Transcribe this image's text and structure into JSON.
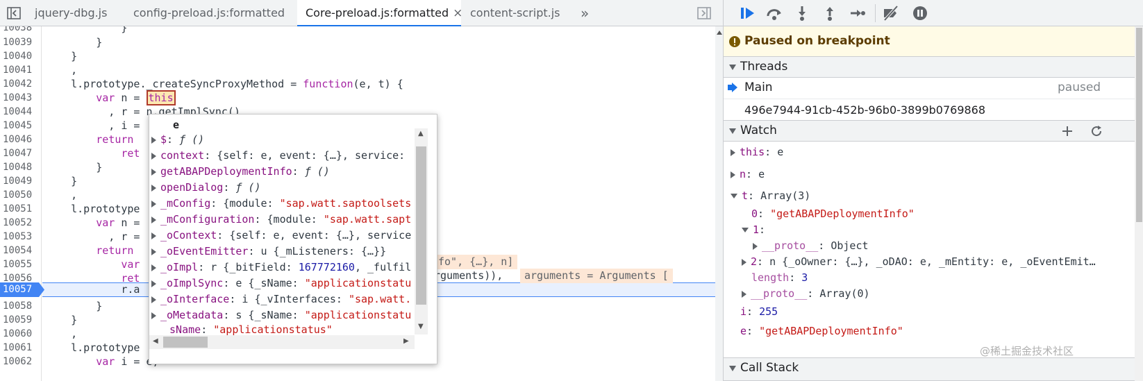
{
  "source": {
    "tabs": [
      {
        "label": "jquery-dbg.js"
      },
      {
        "label": "config-preload.js:formatted"
      },
      {
        "label": "Core-preload.js:formatted",
        "close": "×"
      },
      {
        "label": "content-script.js"
      }
    ],
    "more_tabs": "»",
    "line_numbers": [
      "10038",
      "10039",
      "10040",
      "10041",
      "10042",
      "10043",
      "10044",
      "10045",
      "10046",
      "10047",
      "10048",
      "10049",
      "10050",
      "10051",
      "10052",
      "10053",
      "10054",
      "10055",
      "10056",
      "10057",
      "10058",
      "10059",
      "10060",
      "10061",
      "10062"
    ],
    "paused_line": "10057",
    "code": {
      "l0": "            }",
      "l1": "        }",
      "l2": "    }",
      "l3": "    ,",
      "l4_a": "    l.prototype._createSyncProxyMethod = ",
      "l4_kw": "function",
      "l4_b": "(e, t) {",
      "l5_kw": "        var",
      "l5_a": " n = ",
      "l5_this": "this",
      "l6": "          , r = n.getImplSync()",
      "l7": "          , i = ",
      "l8_kw": "        return",
      "l9": "            ret",
      "l10": "        }",
      "l11": "    }",
      "l12": "    ,",
      "l13": "    l.prototype",
      "l14_kw": "        var",
      "l14_a": " n =",
      "l15": "          , r =",
      "l16_kw": "        return",
      "l17": "            var",
      "l18": "            ret",
      "l19": "            r.a",
      "l20": "        }",
      "l21": "    }",
      "l22": "    ,",
      "l23": "    l.prototype",
      "l24_kw": "        var",
      "l24_a": " i = e;"
    },
    "inline_evals": {
      "line55": "fo\", {…}, n]",
      "line56_pre": "rguments)),",
      "line56": "arguments = Arguments ["
    }
  },
  "popover": {
    "title": "e",
    "rows": [
      {
        "key": "$",
        "value": "ƒ ()"
      },
      {
        "key": "context",
        "value": "{self: e, event: {…}, service:"
      },
      {
        "key": "getABAPDeploymentInfo",
        "value": "ƒ ()"
      },
      {
        "key": "openDialog",
        "value": "ƒ ()"
      },
      {
        "key": "_mConfig",
        "value_pre": "{module: ",
        "value_str": "\"sap.watt.saptoolsets"
      },
      {
        "key": "_mConfiguration",
        "value_pre": "{module: ",
        "value_str": "\"sap.watt.sapt"
      },
      {
        "key": "_oContext",
        "value": "{self: e, event: {…}, service"
      },
      {
        "key": "_oEventEmitter",
        "value": "u {_mListeners: {…}}"
      },
      {
        "key": "_oImpl",
        "value_pre": "r {_bitField: ",
        "value_num": "167772160",
        "value_post": ", _fulfil"
      },
      {
        "key": "_oImplSync",
        "value_pre": "e {_sName: ",
        "value_str": "\"applicationstatu"
      },
      {
        "key": "_oInterface",
        "value_pre": "i {_vInterfaces: ",
        "value_str": "\"sap.watt."
      },
      {
        "key": "_oMetadata",
        "value_pre": "s {_sName: ",
        "value_str": "\"applicationstatu"
      },
      {
        "key": "_sName",
        "value_str": "\"applicationstatus\""
      }
    ]
  },
  "debugger": {
    "paused_message": "Paused on breakpoint",
    "threads_title": "Threads",
    "thread_main": "Main",
    "thread_main_status": "paused",
    "thread_other": "496e7944-91cb-452b-96b0-3899b0769868",
    "watch_title": "Watch",
    "watch": {
      "this_key": "this",
      "this_val": "e",
      "n_key": "n",
      "n_val": "e",
      "t_key": "t",
      "t_val": "Array(3)",
      "t0_key": "0",
      "t0_val": "\"getABAPDeploymentInfo\"",
      "t1_key": "1",
      "proto1_key": "__proto__",
      "proto1_val": "Object",
      "t2_key": "2",
      "t2_val": "n {_oOwner: {…}, _oDAO: e, _mEntity: e, _oEventEmit…",
      "length_key": "length",
      "length_val": "3",
      "proto_key": "__proto__",
      "proto_val": "Array(0)",
      "i_key": "i",
      "i_val": "255",
      "e_key": "e",
      "e_val": "\"getABAPDeploymentInfo\""
    },
    "callstack_title": "Call Stack"
  },
  "watermark": "@稀土掘金技术社区",
  "colors": {
    "accent": "#1a73e8",
    "paused_bg": "#fffbe6",
    "breakpoint": "#4285f4"
  }
}
